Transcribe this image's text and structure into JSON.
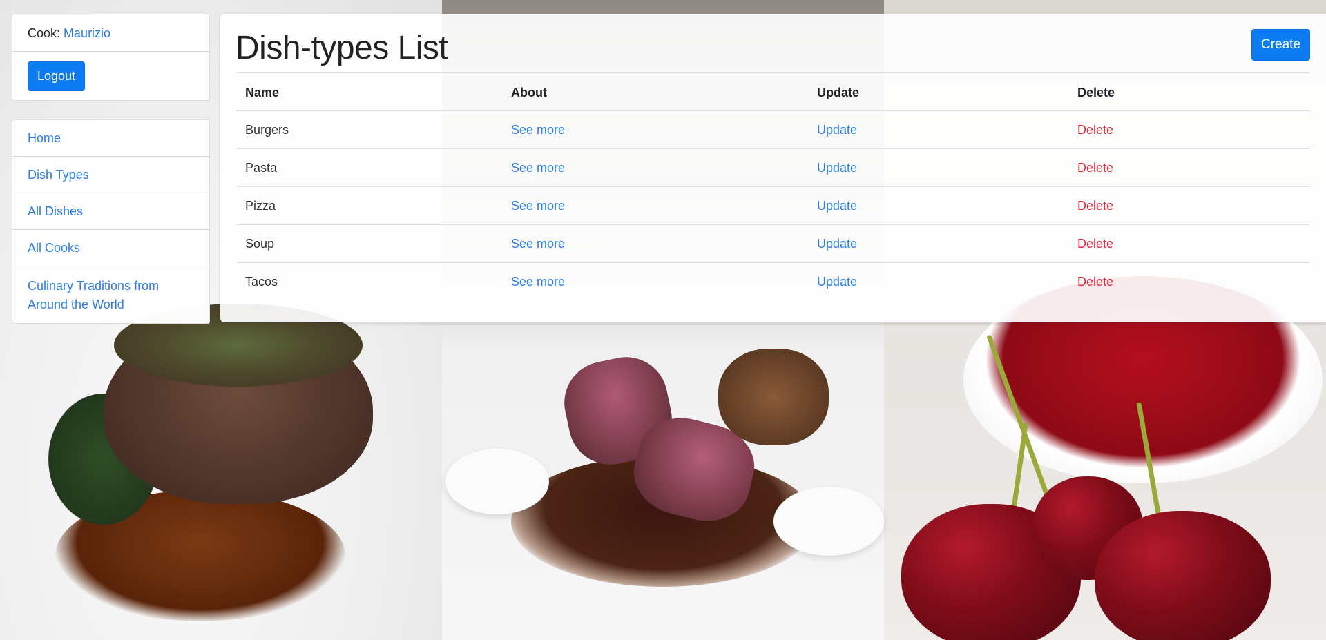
{
  "header": {
    "cook_label": "Cook:",
    "cook_name": "Maurizio",
    "logout_label": "Logout"
  },
  "nav": {
    "items": [
      {
        "label": "Home"
      },
      {
        "label": "Dish Types"
      },
      {
        "label": "All Dishes"
      },
      {
        "label": "All Cooks"
      },
      {
        "label": "Culinary Traditions from Around the World"
      }
    ]
  },
  "main": {
    "title": "Dish-types List",
    "create_label": "Create",
    "table": {
      "columns": [
        "Name",
        "About",
        "Update",
        "Delete"
      ],
      "rows": [
        {
          "name": "Burgers",
          "about": "See more",
          "update": "Update",
          "delete": "Delete"
        },
        {
          "name": "Pasta",
          "about": "See more",
          "update": "Update",
          "delete": "Delete"
        },
        {
          "name": "Pizza",
          "about": "See more",
          "update": "Update",
          "delete": "Delete"
        },
        {
          "name": "Soup",
          "about": "See more",
          "update": "Update",
          "delete": "Delete"
        },
        {
          "name": "Tacos",
          "about": "See more",
          "update": "Update",
          "delete": "Delete"
        }
      ]
    }
  },
  "colors": {
    "primary": "#0d7cf2",
    "link": "#2b7de9",
    "danger": "#e8253a"
  }
}
